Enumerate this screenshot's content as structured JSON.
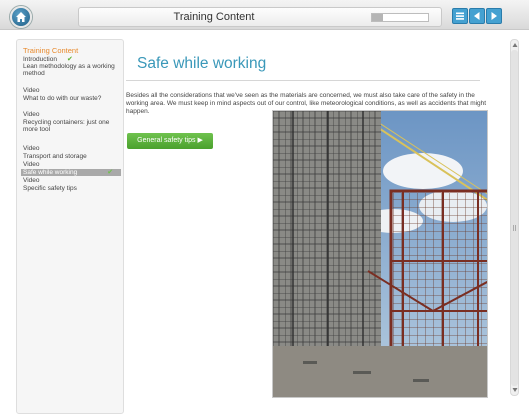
{
  "header": {
    "title": "Training Content",
    "progress_fraction": 0.2,
    "home_icon": "home-icon",
    "menu_icon": "menu-icon",
    "prev_icon": "previous-icon",
    "next_icon": "next-icon"
  },
  "sidebar": {
    "title": "Training Content",
    "items": [
      {
        "label": "Introduction",
        "checked": true
      },
      {
        "label": "Lean methodology as a working method"
      },
      {
        "label": "Video"
      },
      {
        "label": "What to do with our waste?"
      },
      {
        "label": "Video"
      },
      {
        "label": "Recycling containers: just one more tool"
      },
      {
        "label": "Video"
      },
      {
        "label": "Transport and storage"
      },
      {
        "label": "Video"
      },
      {
        "label": "Safe while working",
        "checked": true,
        "active": true
      },
      {
        "label": "Video"
      },
      {
        "label": "Specific safety tips"
      }
    ]
  },
  "main": {
    "title": "Safe while working",
    "body": "Besides all the considerations that we've seen as the materials are concerned, we must also take care of the safety in the working area. We must keep in mind aspects out of our control, like meteorological conditions, as well as accidents that might happen.",
    "tips_button": "General safety tips ▶"
  },
  "colors": {
    "accent_blue": "#3a98b9",
    "sidebar_title": "#e88a2d",
    "green_button": "#4aa12d",
    "nav_button": "#45a1d1"
  }
}
